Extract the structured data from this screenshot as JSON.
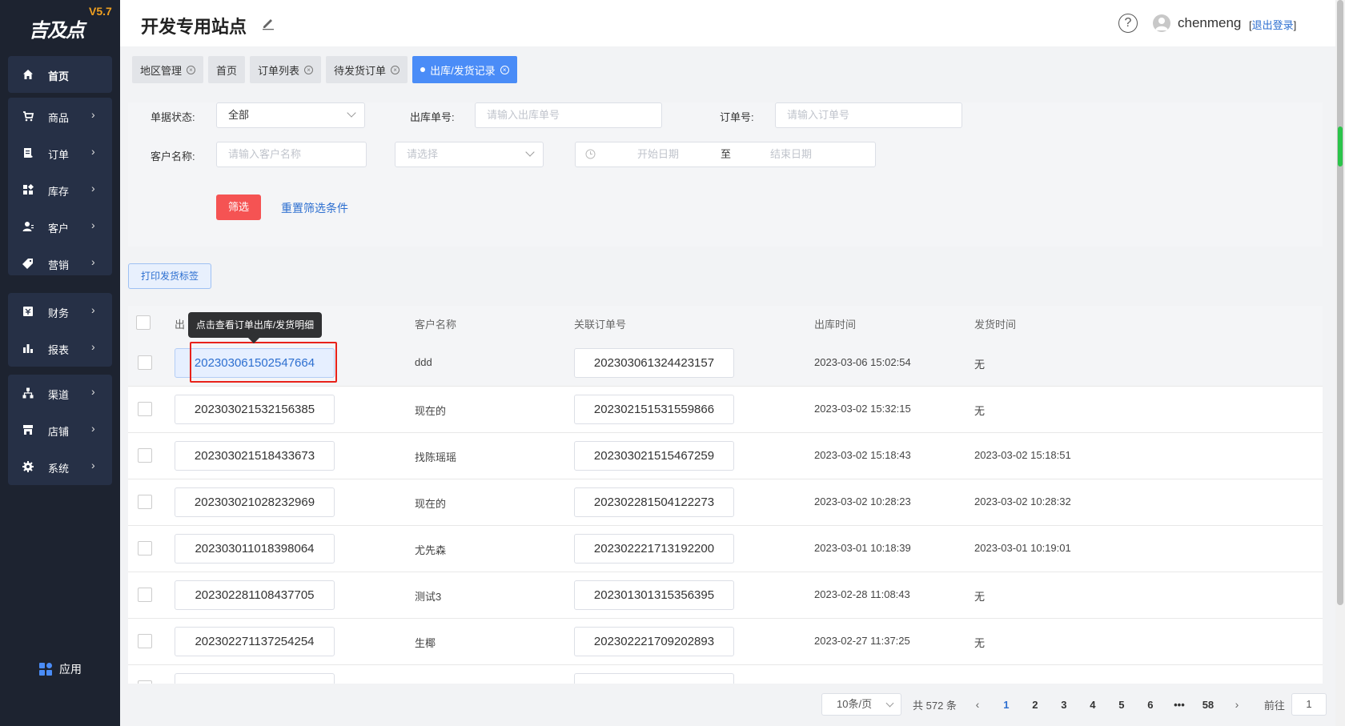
{
  "logo": {
    "brand": "吉及点",
    "version": "V5.7"
  },
  "sidebar": {
    "groups": [
      {
        "items": [
          {
            "label": "首页",
            "icon": "home-icon"
          }
        ]
      },
      {
        "items": [
          {
            "label": "商品",
            "icon": "cart-icon"
          },
          {
            "label": "订单",
            "icon": "order-icon"
          },
          {
            "label": "库存",
            "icon": "inventory-icon"
          },
          {
            "label": "客户",
            "icon": "customer-icon"
          },
          {
            "label": "营销",
            "icon": "tag-icon"
          }
        ]
      },
      {
        "items": [
          {
            "label": "财务",
            "icon": "finance-icon"
          },
          {
            "label": "报表",
            "icon": "report-icon"
          }
        ]
      },
      {
        "items": [
          {
            "label": "渠道",
            "icon": "channel-icon"
          },
          {
            "label": "店铺",
            "icon": "store-icon"
          },
          {
            "label": "系统",
            "icon": "gear-icon"
          }
        ]
      }
    ],
    "app_label": "应用"
  },
  "header": {
    "title": "开发专用站点",
    "help": "?",
    "username": "chenmeng",
    "logout_open": "[",
    "logout_link": "退出登录",
    "logout_close": "]"
  },
  "tabs": [
    {
      "label": "地区管理",
      "active": false
    },
    {
      "label": "首页",
      "active": false,
      "closable": false
    },
    {
      "label": "订单列表",
      "active": false
    },
    {
      "label": "待发货订单",
      "active": false
    },
    {
      "label": "出库/发货记录",
      "active": true
    }
  ],
  "filters": {
    "status_label": "单据状态:",
    "status_value": "全部",
    "outbound_no_label": "出库单号:",
    "outbound_no_placeholder": "请输入出库单号",
    "order_no_label": "订单号:",
    "order_no_placeholder": "请输入订单号",
    "customer_label": "客户名称:",
    "customer_placeholder": "请输入客户名称",
    "select_placeholder": "请选择",
    "start_date_placeholder": "开始日期",
    "date_separator": "至",
    "end_date_placeholder": "结束日期",
    "filter_button": "筛选",
    "reset_button": "重置筛选条件"
  },
  "print_button": "打印发货标签",
  "table": {
    "columns": [
      "出库单号",
      "客户名称",
      "关联订单号",
      "出库时间",
      "发货时间"
    ],
    "column_stub": "出",
    "tooltip": "点击查看订单出库/发货明细",
    "rows": [
      {
        "outbound_no": "202303061502547664",
        "customer": "ddd",
        "order_no": "202303061324423157",
        "out_time": "2023-03-06 15:02:54",
        "ship_time": "无"
      },
      {
        "outbound_no": "202303021532156385",
        "customer": "现在的",
        "order_no": "202302151531559866",
        "out_time": "2023-03-02 15:32:15",
        "ship_time": "无"
      },
      {
        "outbound_no": "202303021518433673",
        "customer": "找陈瑶瑶",
        "order_no": "202303021515467259",
        "out_time": "2023-03-02 15:18:43",
        "ship_time": "2023-03-02 15:18:51"
      },
      {
        "outbound_no": "202303021028232969",
        "customer": "现在的",
        "order_no": "202302281504122273",
        "out_time": "2023-03-02 10:28:23",
        "ship_time": "2023-03-02 10:28:32"
      },
      {
        "outbound_no": "202303011018398064",
        "customer": "尤先森",
        "order_no": "202302221713192200",
        "out_time": "2023-03-01 10:18:39",
        "ship_time": "2023-03-01 10:19:01"
      },
      {
        "outbound_no": "202302281108437705",
        "customer": "测试3",
        "order_no": "202301301315356395",
        "out_time": "2023-02-28 11:08:43",
        "ship_time": "无"
      },
      {
        "outbound_no": "202302271137254254",
        "customer": "生椰",
        "order_no": "202302221709202893",
        "out_time": "2023-02-27 11:37:25",
        "ship_time": "无"
      }
    ]
  },
  "pagination": {
    "page_size": "10条/页",
    "total": "共 572 条",
    "pages": [
      "1",
      "2",
      "3",
      "4",
      "5",
      "6",
      "•••",
      "58"
    ],
    "current": "1",
    "prev": "‹",
    "next": "›",
    "goto_label": "前往",
    "goto_value": "1"
  },
  "colors": {
    "sidebar_bg": "#1d2330",
    "accent": "#4a8cf7",
    "danger": "#f55353",
    "link": "#2d6fd0"
  }
}
